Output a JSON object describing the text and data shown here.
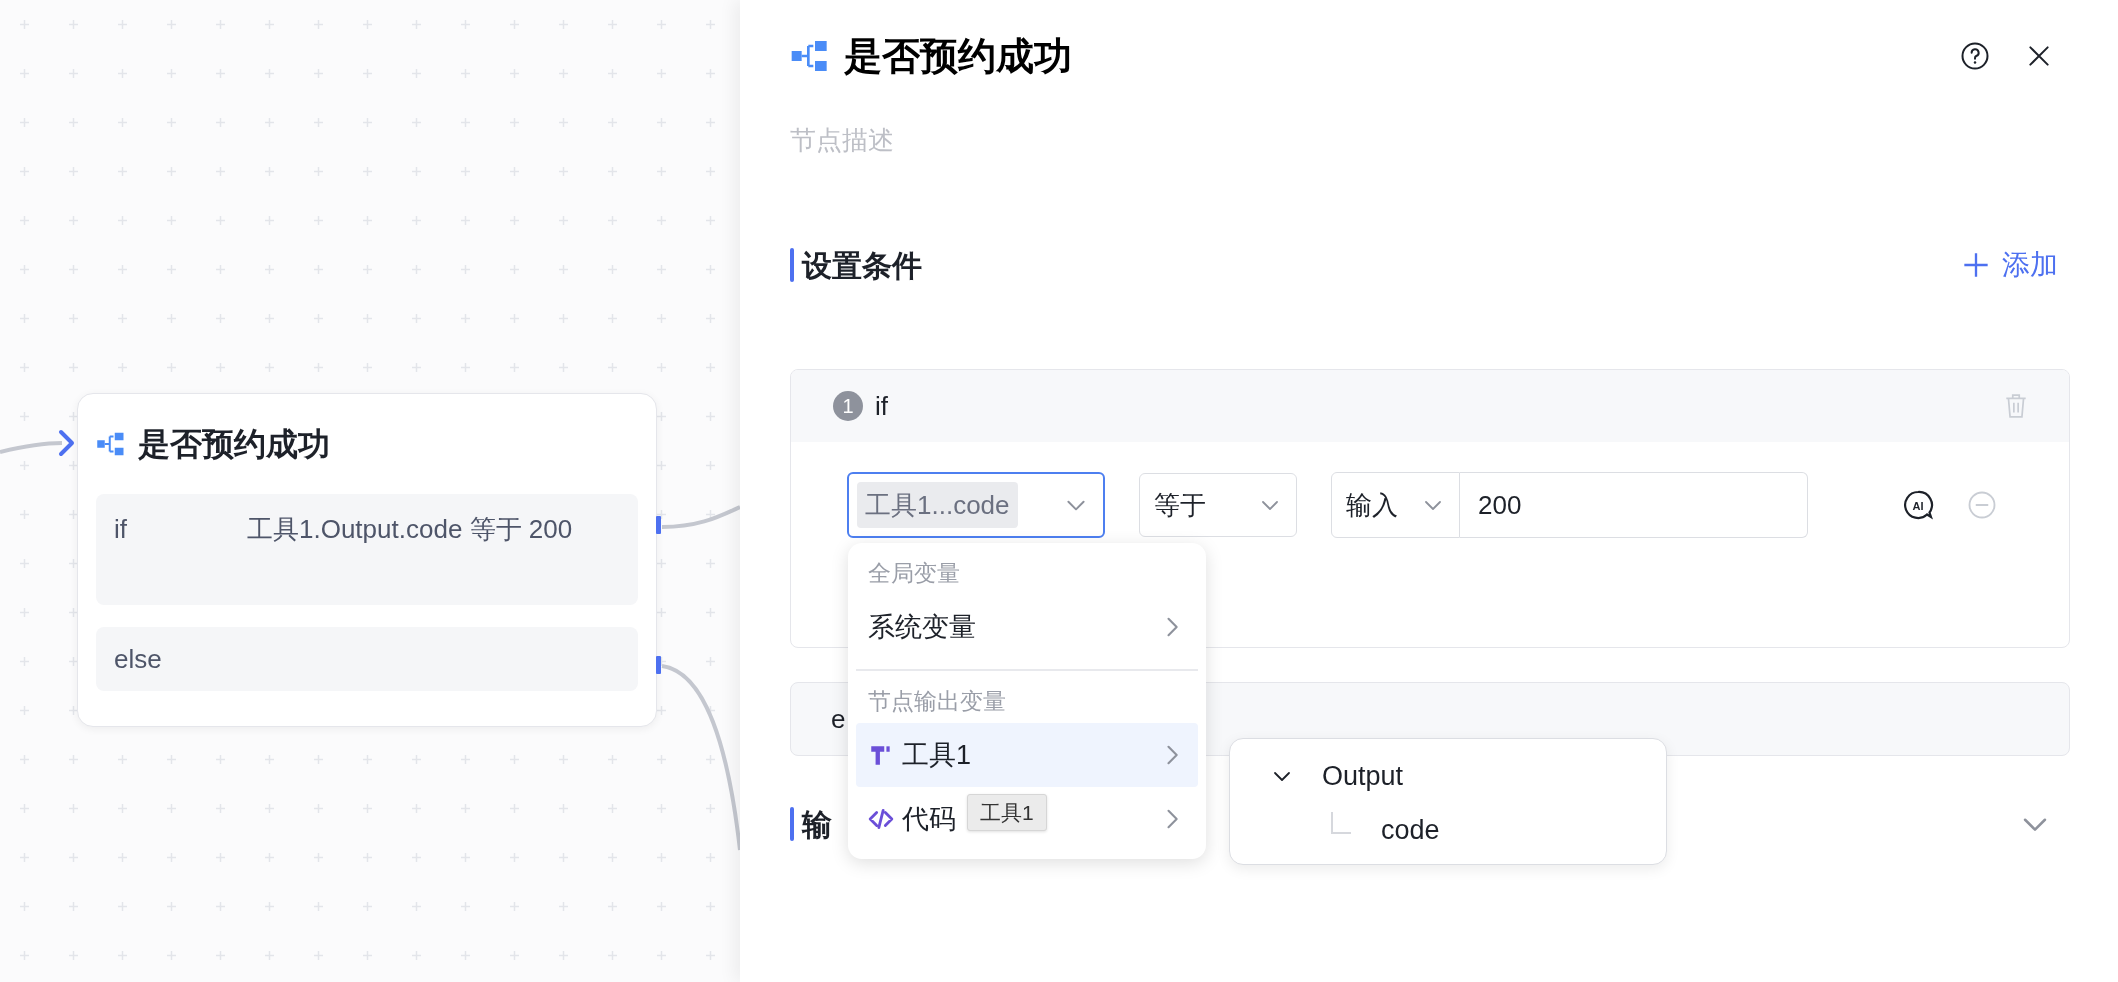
{
  "canvas": {
    "node": {
      "title": "是否预约成功",
      "branches": [
        {
          "kind": "if",
          "label": "if",
          "condition": "工具1.Output.code 等于 200"
        },
        {
          "kind": "else",
          "label": "else"
        }
      ]
    }
  },
  "panel": {
    "title": "是否预约成功",
    "description_placeholder": "节点描述",
    "conditions_section": {
      "title": "设置条件",
      "add_button": "添加"
    },
    "condition_cards": [
      {
        "kind": "if",
        "number": "1",
        "label": "if",
        "rules": [
          {
            "variable": "工具1...code",
            "operator": "等于",
            "value_type": "输入",
            "value": "200",
            "ai_label": "AI"
          }
        ]
      },
      {
        "kind": "else",
        "label": "e"
      }
    ],
    "output_section": {
      "title": "输"
    }
  },
  "variable_menu": {
    "groups": [
      {
        "title": "全局变量",
        "items": [
          {
            "label": "系统变量",
            "kind": "plain",
            "selected": false
          }
        ]
      },
      {
        "title": "节点输出变量",
        "items": [
          {
            "label": "工具1",
            "kind": "tool",
            "selected": true
          },
          {
            "label": "代码",
            "kind": "code",
            "selected": false
          }
        ]
      }
    ]
  },
  "tooltip": "工具1",
  "submenu": {
    "tree": [
      {
        "label": "Output",
        "expanded": true,
        "children": [
          {
            "label": "code"
          }
        ]
      }
    ]
  }
}
